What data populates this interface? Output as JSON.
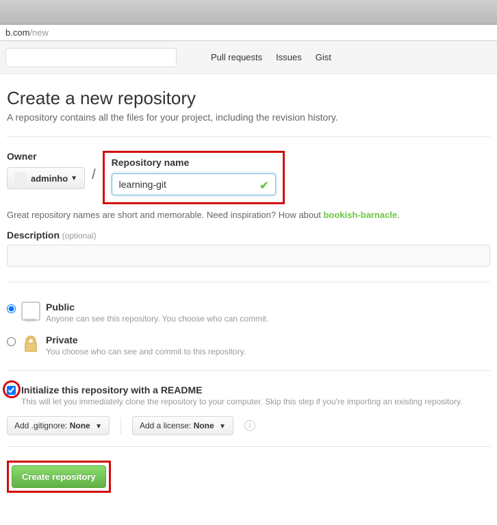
{
  "url": {
    "host": "b.com",
    "path": "/new"
  },
  "nav": {
    "pull_requests": "Pull requests",
    "issues": "Issues",
    "gist": "Gist"
  },
  "page": {
    "title": "Create a new repository",
    "subtitle": "A repository contains all the files for your project, including the revision history."
  },
  "form": {
    "owner_label": "Owner",
    "owner_name": "adminho",
    "repo_label": "Repository name",
    "repo_value": "learning-git",
    "hint_prefix": "Great repository names are short and memorable. Need inspiration? How about ",
    "hint_suggestion": "bookish-barnacle",
    "hint_suffix": ".",
    "description_label": "Description",
    "optional_text": "(optional)",
    "description_value": "",
    "public_label": "Public",
    "public_desc": "Anyone can see this repository. You choose who can commit.",
    "private_label": "Private",
    "private_desc": "You choose who can see and commit to this repository.",
    "init_label": "Initialize this repository with a README",
    "init_desc": "This will let you immediately clone the repository to your computer. Skip this step if you're importing an existing repository.",
    "gitignore_prefix": "Add .gitignore: ",
    "gitignore_value": "None",
    "license_prefix": "Add a license: ",
    "license_value": "None",
    "create_label": "Create repository"
  }
}
